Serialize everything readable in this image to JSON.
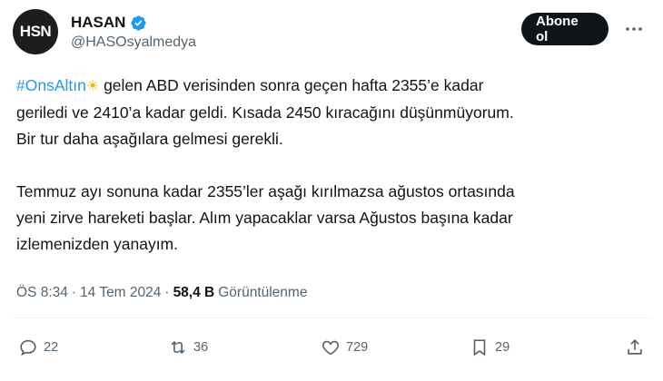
{
  "user": {
    "avatar_text": "HSN",
    "display_name": "HASAN",
    "handle": "@HASOsyalmedya"
  },
  "follow_button": "Abone ol",
  "tweet": {
    "hashtag": "#OnsAltın",
    "emoji": "☀",
    "line1_rest": " gelen ABD verisinden sonra geçen hafta 2355’e kadar",
    "line2": "geriledi ve 2410’a kadar geldi. Kısada 2450 kıracağını düşünmüyorum.",
    "line3": "Bir tur daha aşağılara gelmesi gerekli.",
    "line4": "Temmuz ayı sonuna kadar 2355’ler aşağı kırılmazsa ağustos ortasında",
    "line5": "yeni zirve hareketi başlar. Alım yapacaklar varsa Ağustos başına kadar",
    "line6": "izlemenizden yanayım."
  },
  "meta": {
    "time": "ÖS 8:34",
    "sep1": "·",
    "date": "14 Tem 2024",
    "sep2": "·",
    "views": "58,4 B",
    "views_label": "Görüntülenme"
  },
  "actions": {
    "replies": "22",
    "reposts": "36",
    "likes": "729",
    "bookmarks": "29"
  },
  "icons": {
    "verified": "verified-badge-icon",
    "more": "more-icon",
    "reply": "reply-icon",
    "repost": "repost-icon",
    "like": "heart-icon",
    "bookmark": "bookmark-icon",
    "share": "share-icon"
  },
  "colors": {
    "accent": "#1d9bf0",
    "muted": "#536471",
    "text": "#0f1419"
  }
}
